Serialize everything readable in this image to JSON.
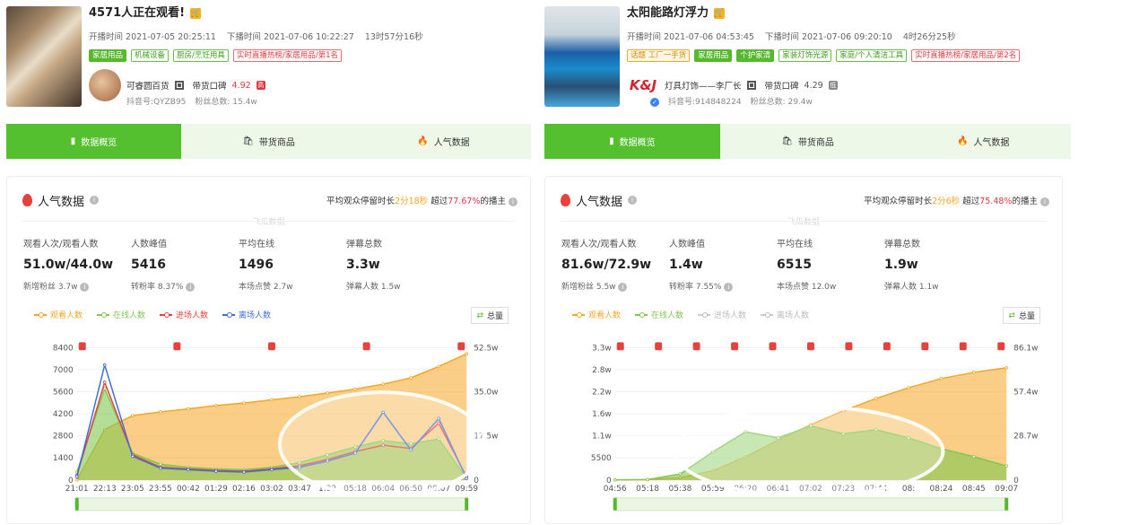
{
  "rooms": [
    {
      "title": "4571人正在观看!",
      "start_time": "开播时间 2021-07-05 20:25:11",
      "end_time": "下播时间 2021-07-06 10:22:27",
      "duration": "13时57分16秒",
      "tags": [
        "家居用品",
        "机械设备",
        "厨房/烹饪用具",
        "实时直播热榜/家居用品/第1名"
      ],
      "shop_name": "可睿圆百货",
      "rating_label": "带货口碑",
      "rating": "4.92",
      "rating_badge": "高",
      "douyin_id": "抖音号:QYZB95",
      "fans": "粉丝总数: 15.4w",
      "tabs": [
        "数据概览",
        "带货商品",
        "人气数据"
      ],
      "card_title": "人气数据",
      "summary": {
        "prefix": "平均观众停留时长",
        "stay": "2分18秒",
        "mid": "超过",
        "pct": "77.67%",
        "suffix": "的播主"
      },
      "watermark": "飞瓜数据",
      "stats": [
        {
          "label": "观看人次/观看人数",
          "value": "51.0w/44.0w",
          "sub": "新增粉丝 3.7w"
        },
        {
          "label": "人数峰值",
          "value": "5416",
          "sub": "转粉率 8.37%"
        },
        {
          "label": "平均在线",
          "value": "1496",
          "sub": "本场点赞 2.7w"
        },
        {
          "label": "弹幕总数",
          "value": "3.3w",
          "sub": "弹幕人数 1.5w"
        }
      ],
      "legend": [
        {
          "name": "观看人数",
          "color": "#f5a623",
          "active": true
        },
        {
          "name": "在线人数",
          "color": "#7fc851",
          "active": true
        },
        {
          "name": "进场人数",
          "color": "#e8413c",
          "active": true
        },
        {
          "name": "离场人数",
          "color": "#3d6fe0",
          "active": true
        }
      ],
      "total_btn": "总量",
      "chart_data": {
        "type": "line",
        "x": [
          "21:01",
          "22:13",
          "23:05",
          "23:55",
          "00:42",
          "01:29",
          "02:16",
          "03:02",
          "03:47",
          "04:32",
          "05:18",
          "06:04",
          "06:50",
          "08:07",
          "09:59"
        ],
        "x_tick_labels": [
          "21:01",
          "22:13",
          "23:05",
          "23:55",
          "00:42",
          "01:29",
          "02:16",
          "03:02",
          "03:47",
          "1:32",
          "05:18",
          "06:04",
          "06:50",
          "08:07",
          "09:59"
        ],
        "y_left_ticks": [
          "0",
          "1400",
          "2800",
          "4200",
          "5600",
          "7000",
          "8400"
        ],
        "y_left_range": [
          0,
          8400
        ],
        "y_right_ticks": [
          "0",
          "17.5w",
          "35.0w",
          "52.5w"
        ],
        "y_right_range": [
          0,
          525000
        ],
        "series": [
          {
            "name": "观看人数",
            "axis": "right",
            "color": "#f5a623",
            "values": [
              0,
              200000,
              255000,
              270000,
              282000,
              295000,
              305000,
              318000,
              330000,
              345000,
              360000,
              380000,
              405000,
              450000,
              500000
            ]
          },
          {
            "name": "在线人数",
            "axis": "left",
            "color": "#7fc851",
            "values": [
              500,
              5800,
              1700,
              1000,
              800,
              700,
              650,
              800,
              1100,
              1600,
              2100,
              2500,
              2300,
              2600,
              100
            ]
          },
          {
            "name": "进场人数",
            "axis": "left",
            "color": "#e8413c",
            "values": [
              300,
              6200,
              1600,
              800,
              700,
              600,
              550,
              700,
              900,
              1300,
              1800,
              2200,
              2000,
              3600,
              200
            ]
          },
          {
            "name": "离场人数",
            "axis": "left",
            "color": "#3d6fe0",
            "values": [
              200,
              7300,
              1500,
              750,
              650,
              550,
              500,
              650,
              800,
              1200,
              1700,
              4300,
              1900,
              3900,
              100
            ]
          }
        ],
        "bag_marks": 5
      }
    },
    {
      "title": "太阳能路灯浮力",
      "start_time": "开播时间 2021-07-06 04:53:45",
      "end_time": "下播时间 2021-07-06 09:20:10",
      "duration": "4时26分25秒",
      "tags": [
        "话题 工厂一手货",
        "家居用品",
        "个护家清",
        "家装灯饰光源",
        "家庭/个人清洁工具",
        "实时直播热榜/家居用品/第2名"
      ],
      "shop_name": "灯具灯饰——李厂长",
      "rating_label": "带货口碑",
      "rating": "4.29",
      "rating_badge": "低",
      "douyin_id": "抖音号:914848224",
      "fans": "粉丝总数: 29.4w",
      "logo_text": "K&J",
      "tabs": [
        "数据概览",
        "带货商品",
        "人气数据"
      ],
      "card_title": "人气数据",
      "summary": {
        "prefix": "平均观众停留时长",
        "stay": "2分6秒",
        "mid": "超过",
        "pct": "75.48%",
        "suffix": "的播主"
      },
      "watermark": "飞瓜数据",
      "stats": [
        {
          "label": "观看人次/观看人数",
          "value": "81.6w/72.9w",
          "sub": "新增粉丝 5.5w"
        },
        {
          "label": "人数峰值",
          "value": "1.4w",
          "sub": "转粉率 7.55%"
        },
        {
          "label": "平均在线",
          "value": "6515",
          "sub": "本场点赞 12.0w"
        },
        {
          "label": "弹幕总数",
          "value": "1.9w",
          "sub": "弹幕人数 1.1w"
        }
      ],
      "legend": [
        {
          "name": "观看人数",
          "color": "#f5a623",
          "active": true
        },
        {
          "name": "在线人数",
          "color": "#7fc851",
          "active": true
        },
        {
          "name": "进场人数",
          "color": "#e8413c",
          "active": false
        },
        {
          "name": "离场人数",
          "color": "#3d6fe0",
          "active": false
        }
      ],
      "total_btn": "总量",
      "chart_data": {
        "type": "line",
        "x": [
          "04:56",
          "05:18",
          "05:38",
          "05:59",
          "06:20",
          "06:41",
          "07:02",
          "07:23",
          "07:44",
          "08:04",
          "08:24",
          "08:45",
          "09:07"
        ],
        "x_tick_labels": [
          "04:56",
          "05:18",
          "05:38",
          "05:59",
          "06:20",
          "06:41",
          "07:02",
          "07:23",
          "07:44",
          "08:",
          "08:24",
          "08:45",
          "09:07"
        ],
        "y_left_ticks": [
          "0",
          "5500",
          "1.1w",
          "1.6w",
          "2.2w",
          "2.8w",
          "3.3w"
        ],
        "y_left_range": [
          0,
          33000
        ],
        "y_right_ticks": [
          "0",
          "28.7w",
          "57.4w",
          "86.1w"
        ],
        "y_right_range": [
          0,
          861000
        ],
        "series": [
          {
            "name": "观看人数",
            "axis": "right",
            "color": "#f5a623",
            "values": [
              0,
              2000,
              15000,
              60000,
              150000,
              260000,
              360000,
              450000,
              530000,
              600000,
              660000,
              700000,
              730000
            ]
          },
          {
            "name": "在线人数",
            "axis": "left",
            "color": "#7fc851",
            "values": [
              0,
              100,
              1500,
              7000,
              12000,
              10500,
              13500,
              11500,
              12500,
              10500,
              7800,
              5800,
              3500
            ]
          }
        ],
        "bag_marks": 11
      }
    }
  ]
}
